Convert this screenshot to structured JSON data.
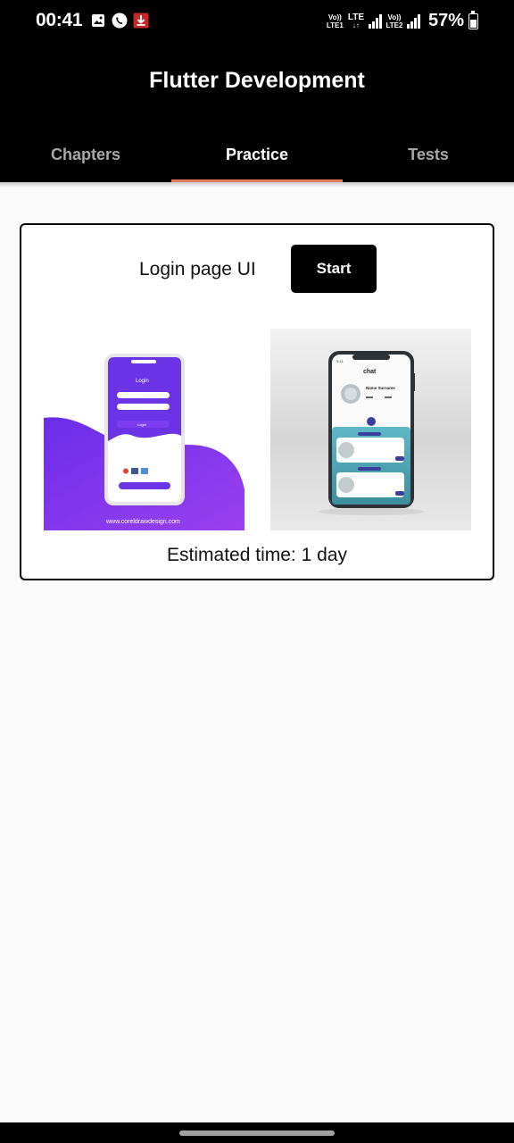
{
  "status_bar": {
    "time": "00:41",
    "net1_top": "Vo))",
    "net1_bottom": "LTE1",
    "net_lte": "LTE",
    "net_lte_arrows": "↓↑",
    "net2_top": "Vo))",
    "net2_bottom": "LTE2",
    "battery": "57%",
    "icons": [
      "gallery-icon",
      "phone-call-icon",
      "download-icon",
      "signal-icon",
      "battery-icon"
    ]
  },
  "app_bar": {
    "title": "Flutter Development",
    "tabs": [
      {
        "label": "Chapters",
        "active": false
      },
      {
        "label": "Practice",
        "active": true
      },
      {
        "label": "Tests",
        "active": false
      }
    ],
    "accent_color": "#e07a5f"
  },
  "practice_card": {
    "title": "Login page UI",
    "start_label": "Start",
    "estimated_time": "Estimated time: 1 day",
    "images": {
      "login": {
        "heading": "Login",
        "button": "Login",
        "url": "www.coreldrawdesign.com"
      },
      "chat": {
        "time": "9:41",
        "heading": "chat",
        "name": "Name Surname"
      }
    }
  }
}
